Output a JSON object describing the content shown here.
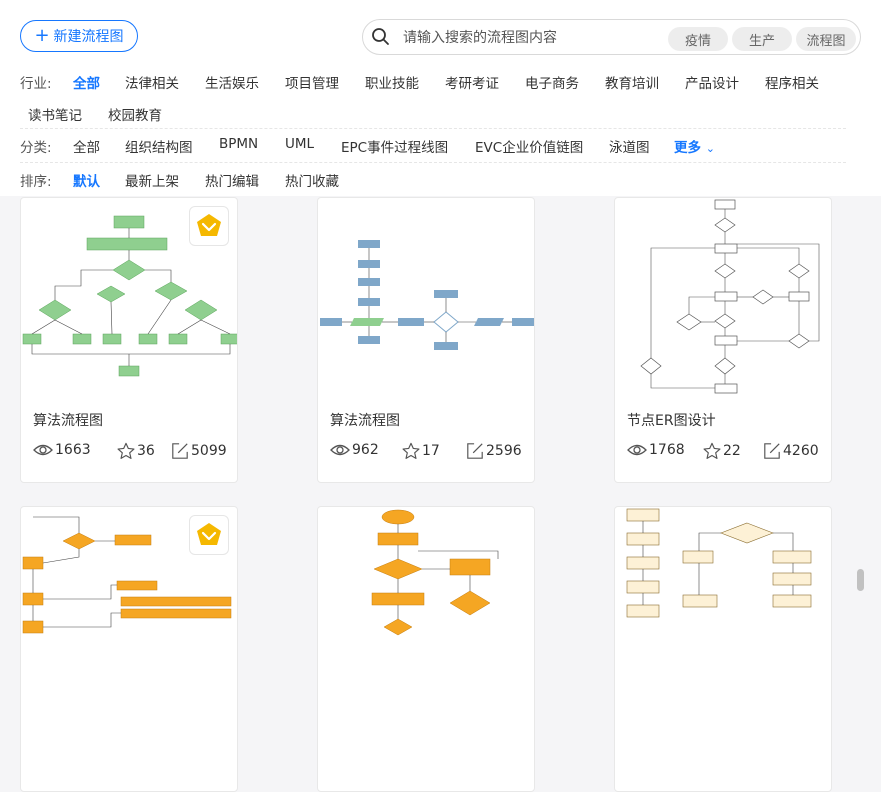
{
  "toolbar": {
    "new_label": "新建流程图"
  },
  "search": {
    "placeholder": "请输入搜索的流程图内容",
    "chips": [
      "疫情",
      "生产",
      "流程图"
    ]
  },
  "filters": {
    "industry": {
      "label": "行业:",
      "items": [
        "全部",
        "法律相关",
        "生活娱乐",
        "项目管理",
        "职业技能",
        "考研考证",
        "电子商务",
        "教育培训",
        "产品设计",
        "程序相关",
        "读书笔记",
        "校园教育"
      ],
      "active_index": 0
    },
    "category": {
      "label": "分类:",
      "items": [
        "全部",
        "组织结构图",
        "BPMN",
        "UML",
        "EPC事件过程线图",
        "EVC企业价值链图",
        "泳道图"
      ],
      "more_label": "更多"
    },
    "sort": {
      "label": "排序:",
      "items": [
        "默认",
        "最新上架",
        "热门编辑",
        "热门收藏"
      ],
      "active_index": 0
    }
  },
  "cards": [
    {
      "title": "算法流程图",
      "views": "1663",
      "stars": "36",
      "edits": "5099",
      "vip": true
    },
    {
      "title": "算法流程图",
      "views": "962",
      "stars": "17",
      "edits": "2596",
      "vip": false
    },
    {
      "title": "节点ER图设计",
      "views": "1768",
      "stars": "22",
      "edits": "4260",
      "vip": false
    },
    {
      "title": "",
      "vip": true
    },
    {
      "title": "",
      "vip": false
    },
    {
      "title": "",
      "vip": false
    }
  ],
  "colors": {
    "accent": "#1677ff",
    "vip_gold": "#f5b800",
    "flow_green": "#8fcf8f",
    "flow_blue": "#7fa7c9",
    "flow_orange": "#f5a623"
  }
}
